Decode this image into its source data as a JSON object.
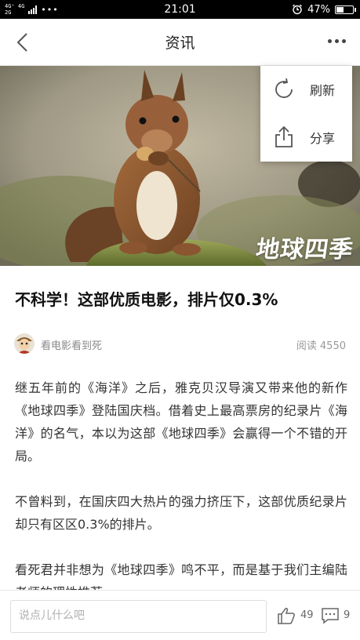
{
  "status_bar": {
    "network_top": "4G⁺ 4G",
    "network_bottom": "2G",
    "more": "•••",
    "time": "21:01",
    "battery": "47%",
    "battery_level": 0.47
  },
  "nav": {
    "title": "资讯"
  },
  "hero": {
    "watermark": "地球四季"
  },
  "menu": {
    "items": [
      {
        "label": "刷新",
        "icon": "refresh-icon"
      },
      {
        "label": "分享",
        "icon": "share-icon"
      }
    ]
  },
  "article": {
    "title": "不科学！这部优质电影，排片仅0.3%",
    "author": "看电影看到死",
    "reads_label": "阅读",
    "reads_count": "4550",
    "paragraphs": [
      "继五年前的《海洋》之后，雅克贝汉导演又带来他的新作《地球四季》登陆国庆档。借着史上最高票房的纪录片《海洋》的名气，本以为这部《地球四季》会赢得一个不错的开局。",
      "不曾料到，在国庆四大热片的强力挤压下，这部优质纪录片却只有区区0.3%的排片。",
      "看死君并非想为《地球四季》鸣不平，而是基于我们主编陆老师的理性推荐。"
    ]
  },
  "comment_bar": {
    "placeholder": "说点儿什么吧",
    "likes": "49",
    "comments": "9"
  }
}
